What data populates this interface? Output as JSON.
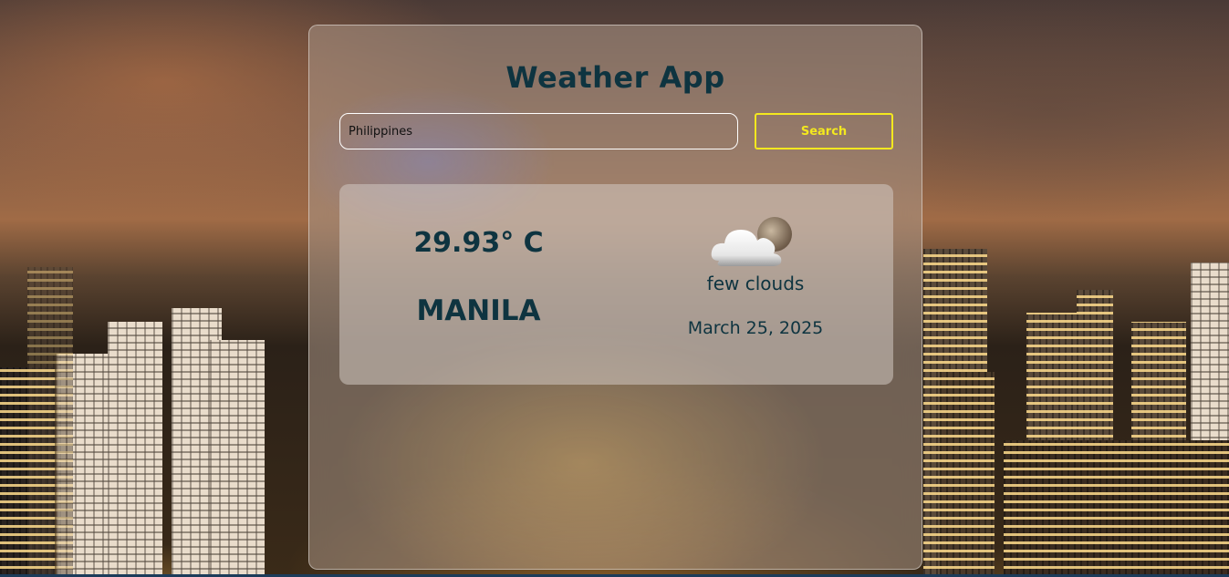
{
  "app": {
    "title": "Weather App"
  },
  "search": {
    "value": "Philippines",
    "button_label": "Search"
  },
  "weather": {
    "temperature": "29.93° C",
    "city": "MANILA",
    "description": "few clouds",
    "date": "March 25, 2025",
    "icon": "few-clouds-night-icon"
  },
  "colors": {
    "title_text": "#0e3440",
    "search_button": "#f3e81f",
    "input_border": "#ffffff"
  }
}
